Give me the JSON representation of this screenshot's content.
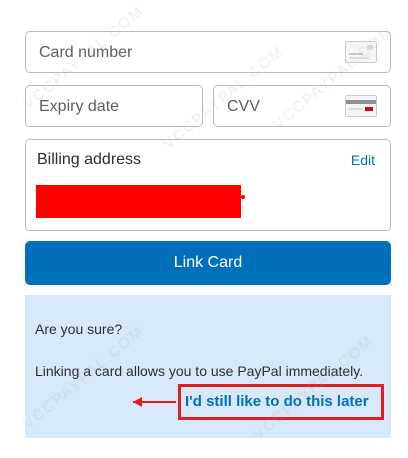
{
  "form": {
    "card_number_placeholder": "Card number",
    "expiry_placeholder": "Expiry date",
    "cvv_placeholder": "CVV"
  },
  "billing": {
    "title": "Billing address",
    "edit_label": "Edit"
  },
  "link_button": "Link Card",
  "confirm": {
    "question": "Are you sure?",
    "message": "Linking a card allows you to use PayPal immediately.",
    "later_link": "I'd still like to do this later"
  },
  "watermark": "VCCPAYPAL.COM",
  "colors": {
    "brand_blue": "#0070ba",
    "panel_bg": "#d7e8fa",
    "highlight_red": "#e02020"
  }
}
